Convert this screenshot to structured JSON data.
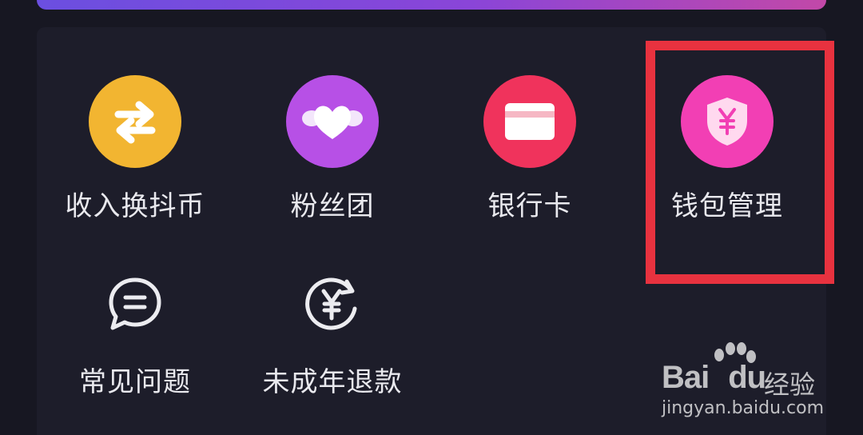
{
  "menu": {
    "items": [
      {
        "label": "收入换抖币",
        "icon": "exchange-icon",
        "color": "#f2b531"
      },
      {
        "label": "粉丝团",
        "icon": "heart-cloud-icon",
        "color": "#b750e6"
      },
      {
        "label": "银行卡",
        "icon": "bank-card-icon",
        "color": "#f0335c"
      },
      {
        "label": "钱包管理",
        "icon": "wallet-shield-icon",
        "color": "#f23fb4",
        "highlighted": true
      },
      {
        "label": "常见问题",
        "icon": "chat-bubble-icon"
      },
      {
        "label": "未成年退款",
        "icon": "yen-refresh-icon"
      }
    ]
  },
  "watermark": {
    "brand": "Bai",
    "brand_suffix": "du",
    "name_cn": "经验",
    "url": "jingyan.baidu.com"
  },
  "colors": {
    "background": "#171722",
    "panel": "#1d1d2a",
    "highlight": "#e8323f"
  }
}
